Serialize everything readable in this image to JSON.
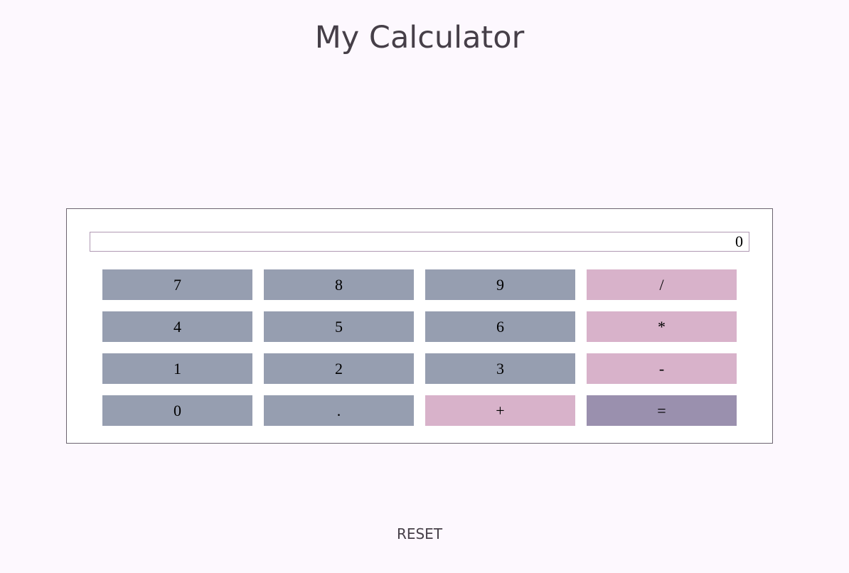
{
  "page": {
    "title": "My Calculator",
    "reset_label": "RESET"
  },
  "calculator": {
    "display_value": "0",
    "keys": {
      "seven": "7",
      "eight": "8",
      "nine": "9",
      "divide": "/",
      "four": "4",
      "five": "5",
      "six": "6",
      "multiply": "*",
      "one": "1",
      "two": "2",
      "three": "3",
      "subtract": "-",
      "zero": "0",
      "decimal": ".",
      "add": "+",
      "equals": "="
    }
  },
  "colors": {
    "background": "#fdf8fe",
    "number_key": "#969eb0",
    "operator_key": "#d8b2ca",
    "equals_key": "#9a90ae",
    "text": "#463f48"
  }
}
